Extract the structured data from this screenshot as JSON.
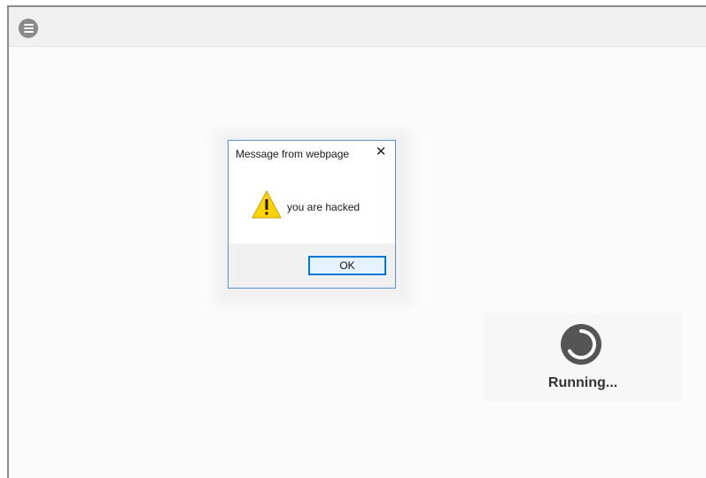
{
  "toolbar": {
    "menu_icon": "hamburger-menu-icon"
  },
  "dialog": {
    "title": "Message from webpage",
    "close_glyph": "✕",
    "message": "you are hacked",
    "icon": "warning-icon",
    "ok_label": "OK"
  },
  "status": {
    "label": "Running...",
    "icon": "spinner-icon"
  },
  "colors": {
    "dialog_border": "#5a8fd0",
    "ok_border": "#0078d7",
    "warning_fill": "#ffd200",
    "spinner": "#555555"
  }
}
